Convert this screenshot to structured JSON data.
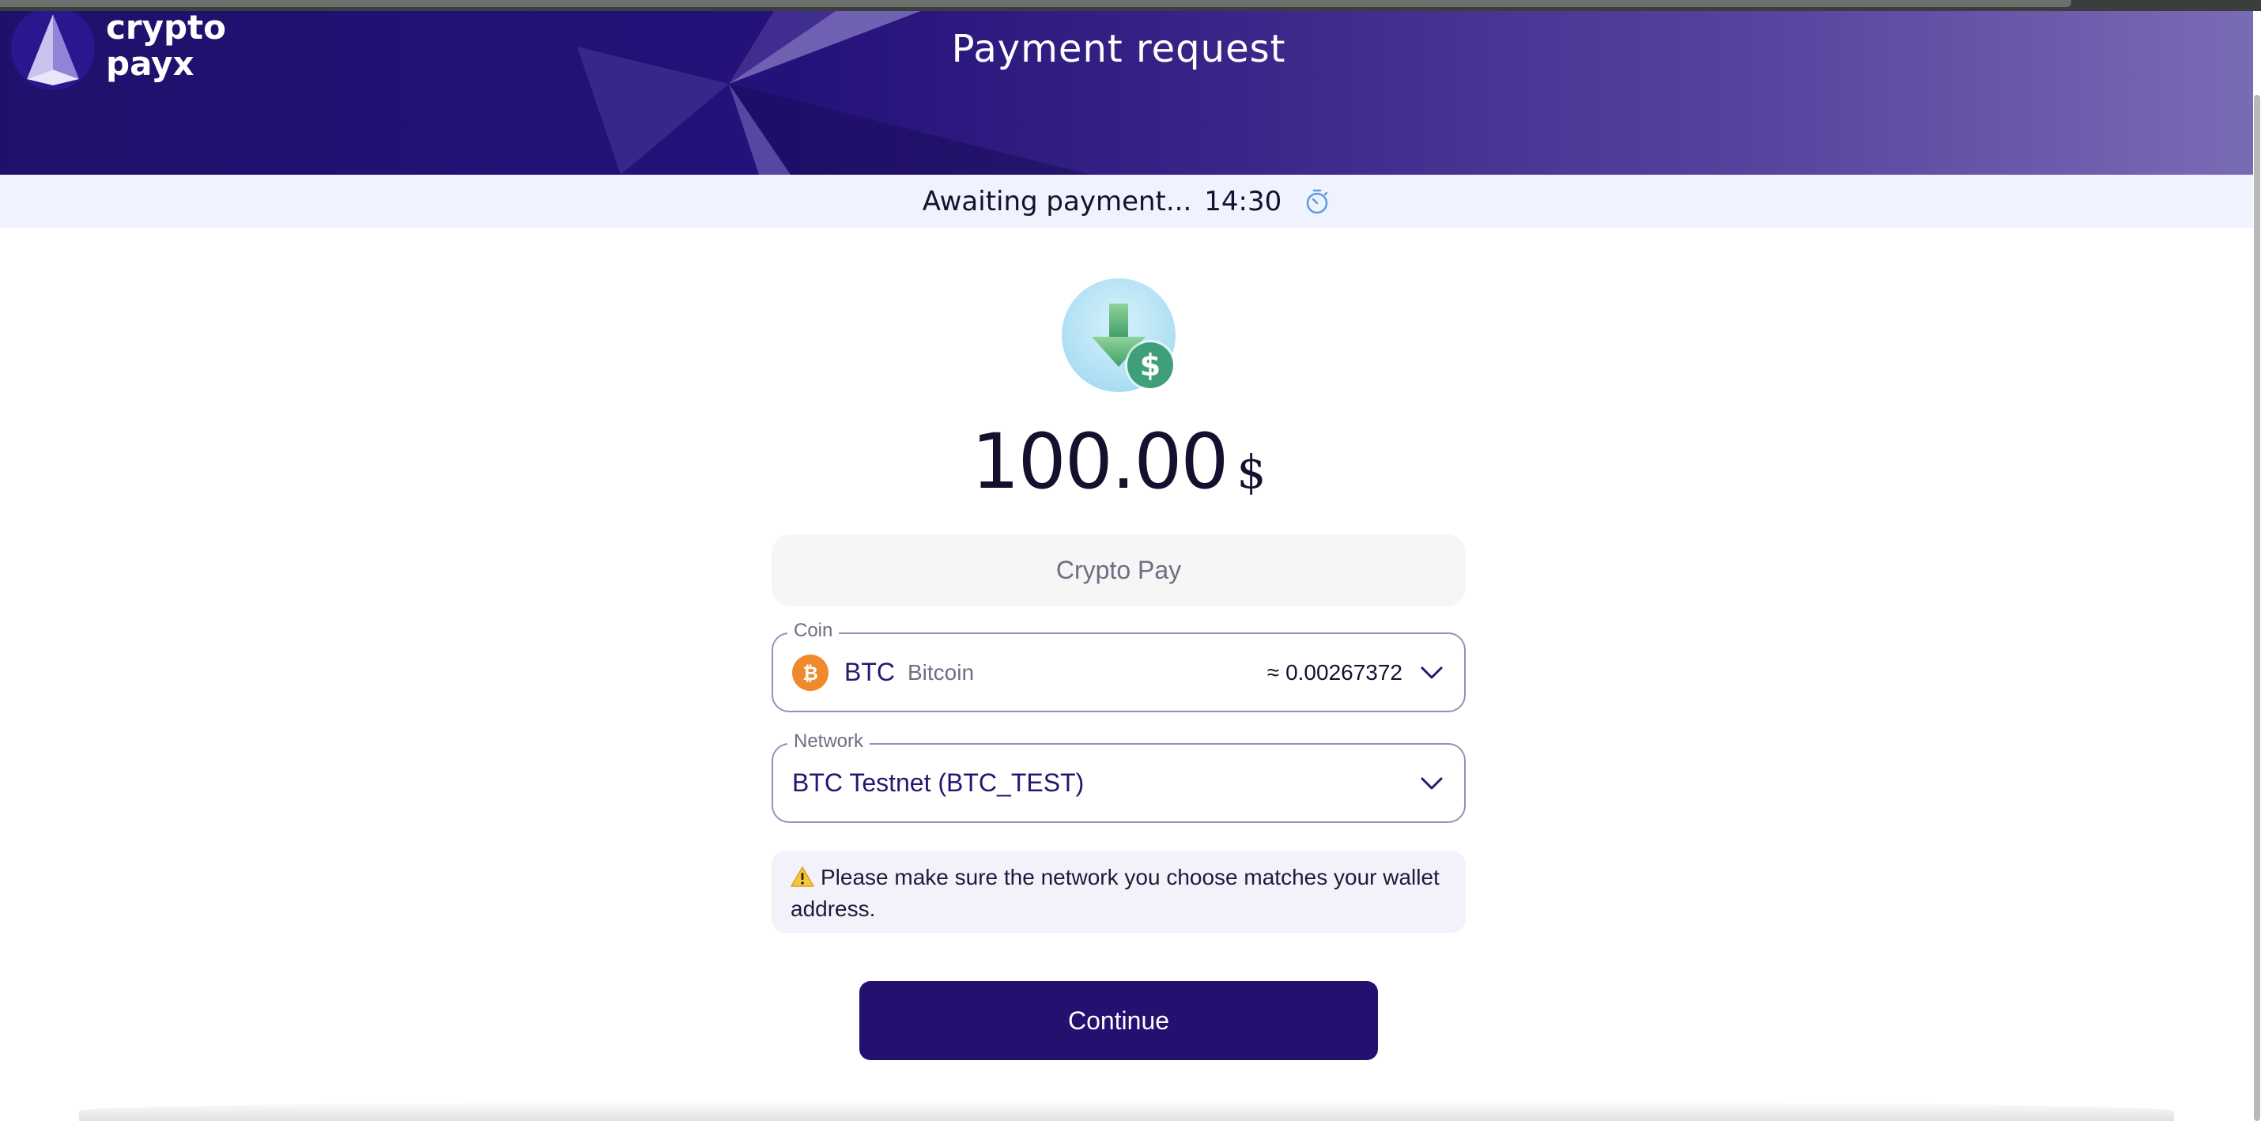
{
  "header": {
    "logo_line1": "crypto",
    "logo_line2": "payx",
    "title": "Payment request"
  },
  "status": {
    "text": "Awaiting payment...",
    "timer": "14:30",
    "icon": "stopwatch-icon"
  },
  "payment": {
    "hero_icon": "receive-money-icon",
    "amount": "100.00",
    "currency": "$",
    "method": "Crypto Pay"
  },
  "coin_field": {
    "legend": "Coin",
    "icon": "bitcoin-icon",
    "symbol": "BTC",
    "name": "Bitcoin",
    "approx_amount": "≈ 0.00267372"
  },
  "network_field": {
    "legend": "Network",
    "value": "BTC Testnet (BTC_TEST)"
  },
  "warning": {
    "icon": "warning-icon",
    "text": "Please make sure the network you choose matches your wallet address."
  },
  "actions": {
    "continue_label": "Continue"
  },
  "colors": {
    "header_dark": "#21106b",
    "header_light": "#7a6bb6",
    "status_bg": "#eef3fd",
    "button_bg": "#23106f",
    "bitcoin": "#f0892b",
    "field_border": "#8c95b8"
  }
}
